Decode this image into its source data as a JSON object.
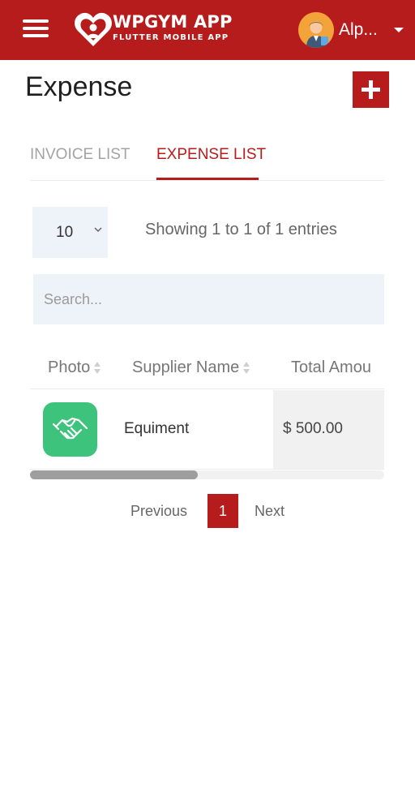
{
  "app": {
    "brand_title": "WPGYM APP",
    "brand_subtitle": "FLUTTER MOBILE APP",
    "user_name": "Alp...",
    "icons": {
      "menu": "menu-icon",
      "logo": "heart-logo",
      "avatar": "user-avatar",
      "dropdown": "caret-down-icon"
    }
  },
  "page": {
    "title": "Expense",
    "add_icon": "plus-icon"
  },
  "tabs": [
    {
      "label": "INVOICE LIST",
      "active": false
    },
    {
      "label": "EXPENSE LIST",
      "active": true
    }
  ],
  "table_controls": {
    "page_size": "10",
    "entries_info": "Showing 1 to 1 of 1 entries",
    "search_placeholder": "Search..."
  },
  "table": {
    "columns": [
      "Photo",
      "Supplier Name",
      "Total Amou"
    ],
    "rows": [
      {
        "photo_icon": "handshake-icon",
        "supplier": "Equiment",
        "amount": "$ 500.00"
      }
    ]
  },
  "pagination": {
    "previous": "Previous",
    "current_page": "1",
    "next": "Next"
  },
  "colors": {
    "primary": "#b71c1c",
    "photo_bg": "#3dc37b",
    "input_bg": "#eef3fa",
    "muted_tab": "#a3a3a3"
  }
}
